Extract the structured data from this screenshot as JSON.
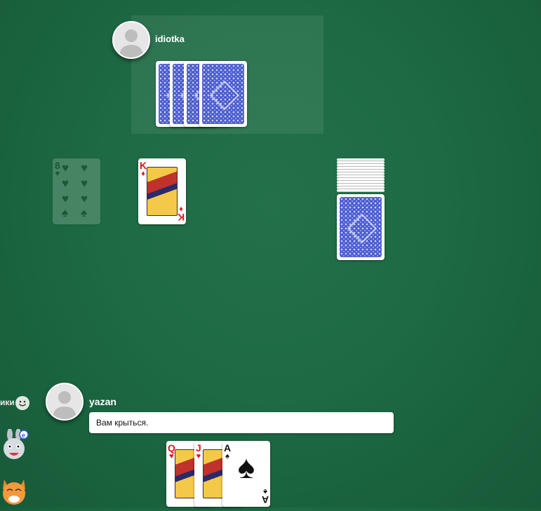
{
  "opponent": {
    "name": "idiotka",
    "hand_count": 4
  },
  "player": {
    "name": "yazan",
    "chat_message": "Вам крыться.",
    "hand": [
      {
        "rank": "Q",
        "suit": "♥",
        "color": "red"
      },
      {
        "rank": "J",
        "suit": "♥",
        "color": "red"
      },
      {
        "rank": "A",
        "suit": "♠",
        "color": "black"
      }
    ]
  },
  "table": {
    "beaten_card": {
      "rank": "8",
      "suit": "♥",
      "faded": true
    },
    "attack_card": {
      "rank": "K",
      "suit": "♦",
      "color": "red"
    },
    "deck": {
      "trump_hidden": true
    }
  },
  "sidebar": {
    "label": "ики"
  },
  "colors": {
    "felt": "#1d6a44",
    "card_back": "#4b5bd0",
    "red_suit": "#e3151b"
  },
  "icons": [
    "avatar-placeholder-icon",
    "smiley-icon",
    "rabbit-sticker-icon",
    "cat-sticker-icon"
  ]
}
